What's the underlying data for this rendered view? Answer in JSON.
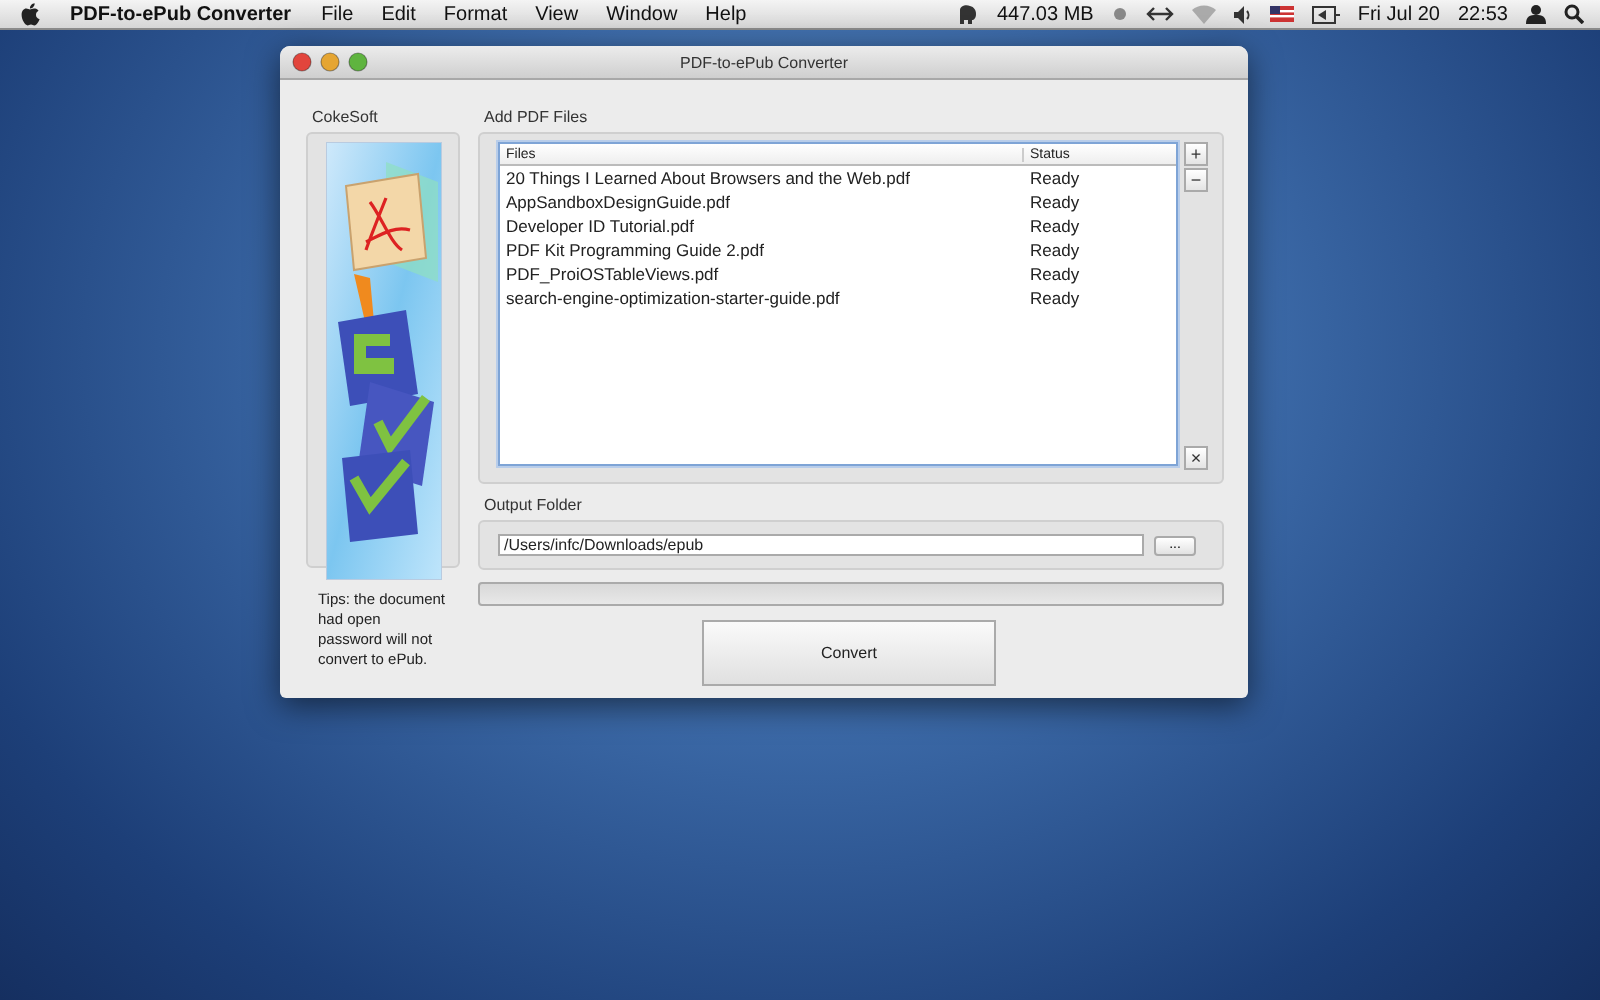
{
  "menu_bar": {
    "app_name": "PDF-to-ePub Converter",
    "menus": [
      "File",
      "Edit",
      "Format",
      "View",
      "Window",
      "Help"
    ],
    "memory": "447.03 MB",
    "date": "Fri Jul 20",
    "time": "22:53"
  },
  "window": {
    "title": "PDF-to-ePub Converter",
    "brand": {
      "label": "CokeSoft"
    },
    "tips": "Tips: the document had open password will not convert to ePub.",
    "files_group": {
      "label": "Add PDF Files",
      "add_button": "+",
      "remove_button": "−",
      "clear_button": "×",
      "table": {
        "columns": [
          "Files",
          "Status"
        ],
        "rows": [
          {
            "file": "20 Things I Learned About Browsers and the Web.pdf",
            "status": "Ready"
          },
          {
            "file": "AppSandboxDesignGuide.pdf",
            "status": "Ready"
          },
          {
            "file": "Developer ID Tutorial.pdf",
            "status": "Ready"
          },
          {
            "file": "PDF Kit Programming Guide 2.pdf",
            "status": "Ready"
          },
          {
            "file": "PDF_ProiOSTableViews.pdf",
            "status": "Ready"
          },
          {
            "file": "search-engine-optimization-starter-guide.pdf",
            "status": "Ready"
          }
        ]
      }
    },
    "output": {
      "label": "Output Folder",
      "value": "/Users/infc/Downloads/epub",
      "browse_button": "..."
    },
    "progress": {
      "level": 0
    },
    "convert_button": "Convert"
  }
}
